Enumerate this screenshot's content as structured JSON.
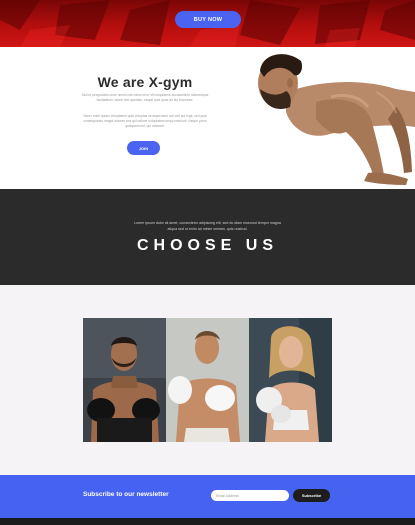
{
  "hero": {
    "buy_label": "BUY NOW"
  },
  "about": {
    "title": "We are X-gym",
    "paragraph_1": "Sed ut perspiciatis unde omnis iste natus error sit voluptatem accusantium doloremque laudantium, totam rem aperiam, eaque ipsa quae ab illo inventore.",
    "paragraph_2": "Nemo enim ipsam voluptatem quia voluptas sit aspernatur aut odit aut fugit, sed quia consequuntur magni dolores eos qui ratione voluptatem sequi nesciunt. Neque porro quisquam est, qui dolorem.",
    "join_label": "JOIN"
  },
  "choose": {
    "intro": "Lorem ipsum dolor sit amet, consectetur adipiscing elit, sed do diam eiusmod tempor magna aliqua sed ut enim ad minim veniam, quis nostrud.",
    "title": "CHOOSE US"
  },
  "newsletter": {
    "label": "Subscribe to our newsletter",
    "email_placeholder": "Email Address",
    "subscribe_label": "Subscribe"
  },
  "colors": {
    "accent": "#4a63f1",
    "dark": "#2b2b2b",
    "hero_red": "#c41212"
  }
}
